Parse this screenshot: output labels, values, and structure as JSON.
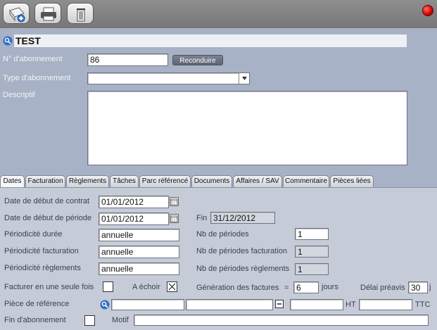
{
  "toolbar": {
    "add_icon": "add-document-icon",
    "print_icon": "printer-icon",
    "delete_icon": "trash-icon",
    "status_color": "#d20000"
  },
  "record": {
    "title": "TEST",
    "labels": {
      "number": "N° d'abonnement",
      "type": "Type d'abonnement",
      "description": "Descriptif"
    },
    "number_value": "86",
    "type_value": "",
    "description_value": "",
    "reconduire_label": "Reconduire"
  },
  "tabs": [
    {
      "label": "Dates"
    },
    {
      "label": "Facturation"
    },
    {
      "label": "Règlements"
    },
    {
      "label": "Tâches"
    },
    {
      "label": "Parc référencé"
    },
    {
      "label": "Documents"
    },
    {
      "label": "Affaires / SAV"
    },
    {
      "label": "Commentaire"
    },
    {
      "label": "Pièces liées"
    }
  ],
  "dates": {
    "contract_start_label": "Date de début de contrat",
    "contract_start_value": "01/01/2012",
    "period_start_label": "Date de début de période",
    "period_start_value": "01/01/2012",
    "end_label": "Fin",
    "end_value": "31/12/2012",
    "periodicity_duration_label": "Périodicité durée",
    "periodicity_duration_value": "annuelle",
    "periodicity_billing_label": "Périodicité facturation",
    "periodicity_billing_value": "annuelle",
    "periodicity_payment_label": "Périodicité règlements",
    "periodicity_payment_value": "annuelle",
    "nb_periods_label": "Nb de périodes",
    "nb_periods_value": "1",
    "nb_periods_billing_label": "Nb de périodes facturation",
    "nb_periods_billing_value": "1",
    "nb_periods_payment_label": "Nb de périodes règlements",
    "nb_periods_payment_value": "1",
    "single_invoice_label": "Facturer en une seule fois",
    "a_echoir_label": "A échoir",
    "generation_label": "Génération des factures",
    "generation_equals": "=",
    "generation_value": "6",
    "generation_unit": "jours",
    "notice_label": "Délai préavis",
    "notice_value": "30",
    "notice_unit": "j",
    "reference_label": "Pièce de référence",
    "ht_label": "HT",
    "ttc_label": "TTC",
    "end_subscription_label": "Fin d'abonnement",
    "motif_label": "Motif"
  }
}
